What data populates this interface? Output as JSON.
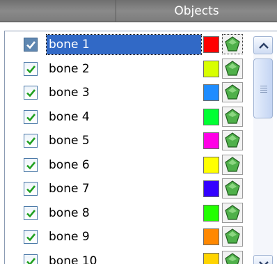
{
  "header": {
    "title": "Objects"
  },
  "items": [
    {
      "label": "bone 1",
      "checked": true,
      "selected": true,
      "color": "#ff0000"
    },
    {
      "label": "bone 2",
      "checked": true,
      "selected": false,
      "color": "#d8ff00"
    },
    {
      "label": "bone 3",
      "checked": true,
      "selected": false,
      "color": "#1e8cff"
    },
    {
      "label": "bone 4",
      "checked": true,
      "selected": false,
      "color": "#00ff33"
    },
    {
      "label": "bone 5",
      "checked": true,
      "selected": false,
      "color": "#ff00e6"
    },
    {
      "label": "bone 6",
      "checked": true,
      "selected": false,
      "color": "#ffff00"
    },
    {
      "label": "bone 7",
      "checked": true,
      "selected": false,
      "color": "#3300ff"
    },
    {
      "label": "bone 8",
      "checked": true,
      "selected": false,
      "color": "#22ff00"
    },
    {
      "label": "bone 9",
      "checked": true,
      "selected": false,
      "color": "#ff8800"
    },
    {
      "label": "bone 10",
      "checked": true,
      "selected": false,
      "color": "#ffd400"
    }
  ],
  "icons": {
    "checkbox": "checkmark-icon",
    "object_type": "green-polygon-icon",
    "scroll_up": "chevron-up-icon",
    "scroll_down": "chevron-down-icon",
    "scroll_grip": "grip-lines-icon"
  },
  "colors": {
    "selection": "#3169c6",
    "checkmark": "#21a121",
    "gem": "#4fb04a"
  }
}
